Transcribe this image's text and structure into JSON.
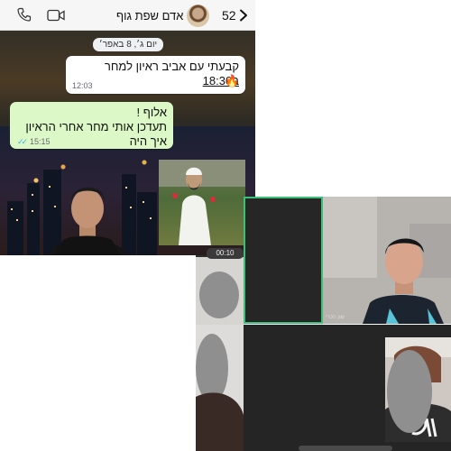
{
  "header": {
    "contact_name": "אדם שפת גוף",
    "unread_count": "52",
    "icons": [
      "back-chevron-icon",
      "video-call-icon",
      "voice-call-icon"
    ]
  },
  "chat": {
    "date_chip": "יום ג׳, 8 באפר׳",
    "incoming": {
      "text_before": "קבעתי עם אביב ראיון למחר ",
      "text_underlined": "ב18:30",
      "emoji": "🔥",
      "time": "12:03"
    },
    "outgoing": {
      "line1": "אלוף !",
      "line2": "תעדכן אותי מחר אחרי הראיון איך היה",
      "time": "15:15",
      "status": "read"
    }
  },
  "video_call": {
    "tiles": [
      {
        "id": "a",
        "state": "blurred"
      },
      {
        "id": "b",
        "state": "camera-off",
        "active_speaker": true
      },
      {
        "id": "c",
        "state": "camera-on"
      },
      {
        "id": "d",
        "state": "blurred"
      },
      {
        "id": "e",
        "state": "camera-off"
      },
      {
        "id": "f",
        "state": "blurred"
      }
    ],
    "participant_label": "שון הכרי",
    "time_chip": "00:10"
  },
  "colors": {
    "wa_header": "#f6f6f6",
    "incoming_bubble": "#ffffff",
    "outgoing_bubble": "#dcf8c6",
    "read_ticks": "#34b7f1",
    "active_speaker_border": "#3dbf7a",
    "call_background": "#252525"
  }
}
